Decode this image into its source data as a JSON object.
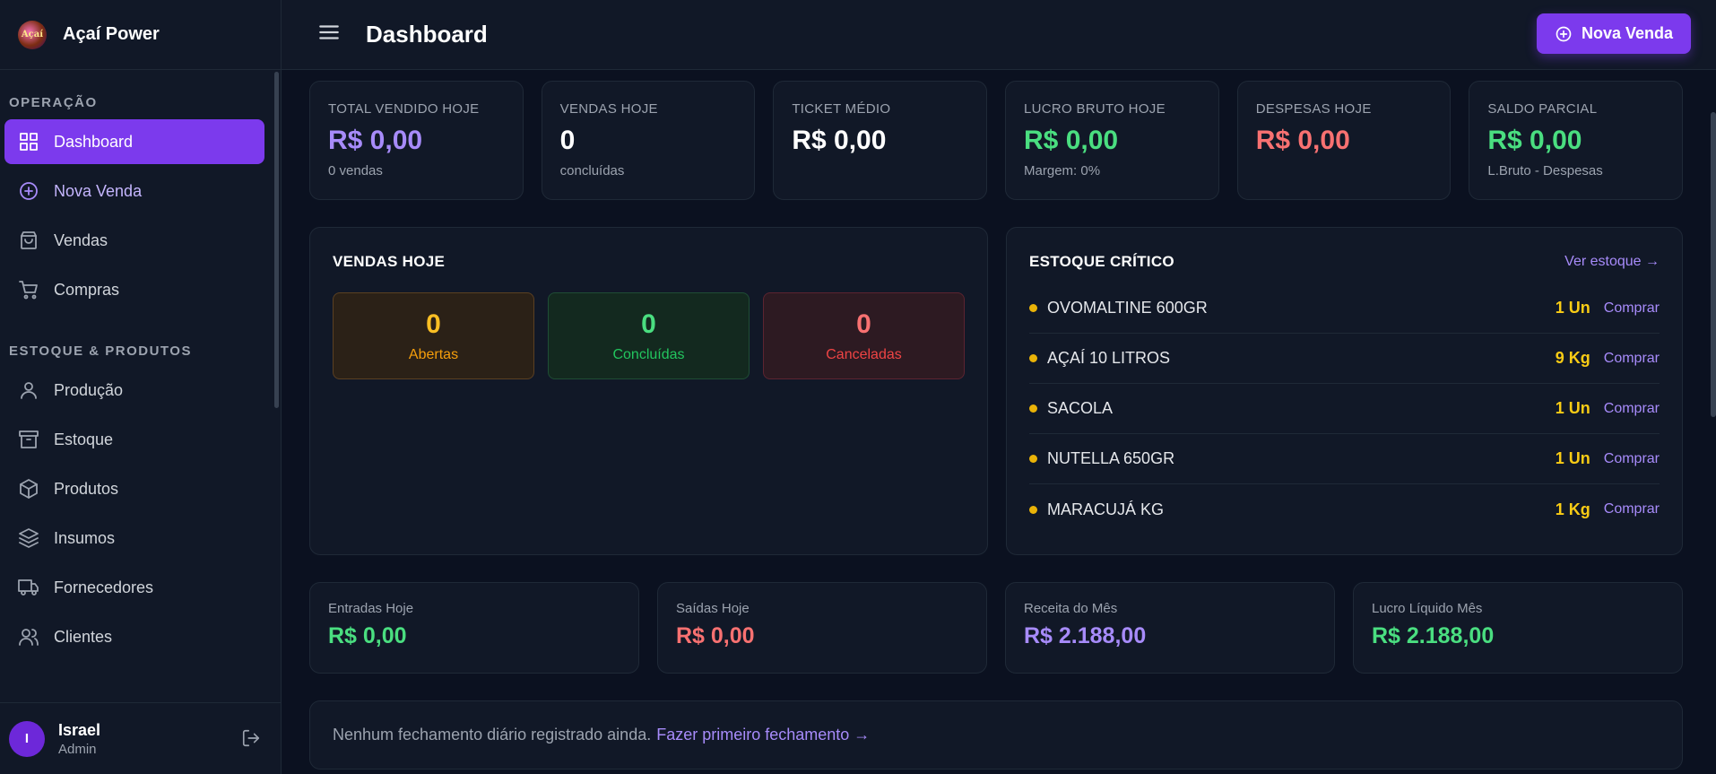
{
  "brand": {
    "name": "Açaí Power",
    "logo_text": "Açaí"
  },
  "sidebar": {
    "sections": [
      {
        "title": "OPERAÇÃO"
      },
      {
        "title": "ESTOQUE & PRODUTOS"
      }
    ],
    "items": [
      {
        "label": "Dashboard",
        "icon": "grid-icon"
      },
      {
        "label": "Nova Venda",
        "icon": "plus-circle-icon"
      },
      {
        "label": "Vendas",
        "icon": "bag-icon"
      },
      {
        "label": "Compras",
        "icon": "cart-icon"
      },
      {
        "label": "Produção",
        "icon": "user-icon"
      },
      {
        "label": "Estoque",
        "icon": "archive-icon"
      },
      {
        "label": "Produtos",
        "icon": "box-icon"
      },
      {
        "label": "Insumos",
        "icon": "layers-icon"
      },
      {
        "label": "Fornecedores",
        "icon": "truck-icon"
      },
      {
        "label": "Clientes",
        "icon": "users-icon"
      }
    ]
  },
  "user": {
    "initial": "I",
    "name": "Israel",
    "role": "Admin"
  },
  "header": {
    "title": "Dashboard",
    "new_sale_label": "Nova Venda"
  },
  "stats": [
    {
      "label": "TOTAL VENDIDO HOJE",
      "value": "R$ 0,00",
      "sub": "0 vendas",
      "color": "#a78bfa"
    },
    {
      "label": "VENDAS HOJE",
      "value": "0",
      "sub": "concluídas",
      "color": "#ffffff"
    },
    {
      "label": "TICKET MÉDIO",
      "value": "R$ 0,00",
      "sub": "",
      "color": "#ffffff"
    },
    {
      "label": "LUCRO BRUTO HOJE",
      "value": "R$ 0,00",
      "sub": "Margem: 0%",
      "color": "#4ade80"
    },
    {
      "label": "DESPESAS HOJE",
      "value": "R$ 0,00",
      "sub": "",
      "color": "#f87171"
    },
    {
      "label": "SALDO PARCIAL",
      "value": "R$ 0,00",
      "sub": "L.Bruto - Despesas",
      "color": "#4ade80"
    }
  ],
  "sales_today": {
    "title": "VENDAS HOJE",
    "open": {
      "count": "0",
      "label": "Abertas"
    },
    "done": {
      "count": "0",
      "label": "Concluídas"
    },
    "cancelled": {
      "count": "0",
      "label": "Canceladas"
    }
  },
  "critical_stock": {
    "title": "ESTOQUE CRÍTICO",
    "see_all": "Ver estoque →",
    "buy_label": "Comprar",
    "items": [
      {
        "name": "OVOMALTINE 600GR",
        "qty": "1 Un"
      },
      {
        "name": "AÇAÍ 10 LITROS",
        "qty": "9 Kg"
      },
      {
        "name": "SACOLA",
        "qty": "1 Un"
      },
      {
        "name": "NUTELLA 650GR",
        "qty": "1 Un"
      },
      {
        "name": "MARACUJÁ KG",
        "qty": "1 Kg"
      }
    ]
  },
  "summary": [
    {
      "label": "Entradas Hoje",
      "value": "R$ 0,00",
      "color": "#4ade80"
    },
    {
      "label": "Saídas Hoje",
      "value": "R$ 0,00",
      "color": "#f87171"
    },
    {
      "label": "Receita do Mês",
      "value": "R$ 2.188,00",
      "color": "#a78bfa"
    },
    {
      "label": "Lucro Líquido Mês",
      "value": "R$ 2.188,00",
      "color": "#4ade80"
    }
  ],
  "closing": {
    "message": "Nenhum fechamento diário registrado ainda.",
    "link": "Fazer primeiro fechamento →"
  }
}
